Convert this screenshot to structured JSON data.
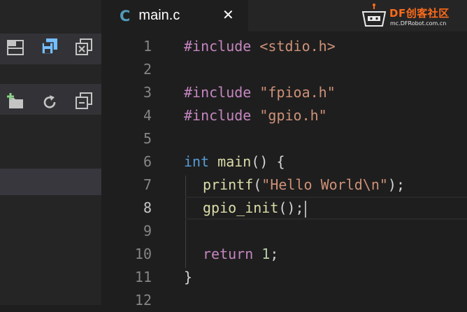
{
  "sidebar": {
    "icons": [
      {
        "name": "collapse-panel-icon"
      },
      {
        "name": "save-all-icon"
      },
      {
        "name": "close-all-icon"
      },
      {
        "name": "new-folder-icon"
      },
      {
        "name": "refresh-icon"
      },
      {
        "name": "collapse-all-icon"
      }
    ]
  },
  "tab": {
    "lang_badge": "C",
    "title": "main.c",
    "close": "✕"
  },
  "watermark": {
    "title": "DF创客社区",
    "subtitle": "mc.DFRobot.com.cn"
  },
  "editor": {
    "lines": [
      {
        "num": "1"
      },
      {
        "num": "2"
      },
      {
        "num": "3"
      },
      {
        "num": "4"
      },
      {
        "num": "5"
      },
      {
        "num": "6"
      },
      {
        "num": "7"
      },
      {
        "num": "8"
      },
      {
        "num": "9"
      },
      {
        "num": "10"
      },
      {
        "num": "11"
      },
      {
        "num": "12"
      }
    ],
    "tokens": {
      "inc1_dir": "#include",
      "inc1_path": "<stdio.h>",
      "inc2_dir": "#include",
      "inc2_path": "\"fpioa.h\"",
      "inc3_dir": "#include",
      "inc3_path": "\"gpio.h\"",
      "int_kw": "int",
      "main_fn": "main",
      "main_rest": "() {",
      "printf_fn": "printf",
      "printf_open": "(",
      "printf_str": "\"Hello World\\n\"",
      "printf_close": ");",
      "gpio_fn": "gpio_init",
      "gpio_rest": "();",
      "return_kw": "return",
      "return_val": "1",
      "return_semi": ";",
      "close_brace": "}"
    }
  },
  "colors": {
    "background": "#1e1e1e",
    "sidebar": "#252526",
    "keyword": "#c586c0",
    "string": "#ce9178",
    "type": "#569cd6",
    "function": "#dcdcaa",
    "number": "#b5cea8",
    "accent": "#519aba",
    "watermark": "#ff6b1a"
  }
}
